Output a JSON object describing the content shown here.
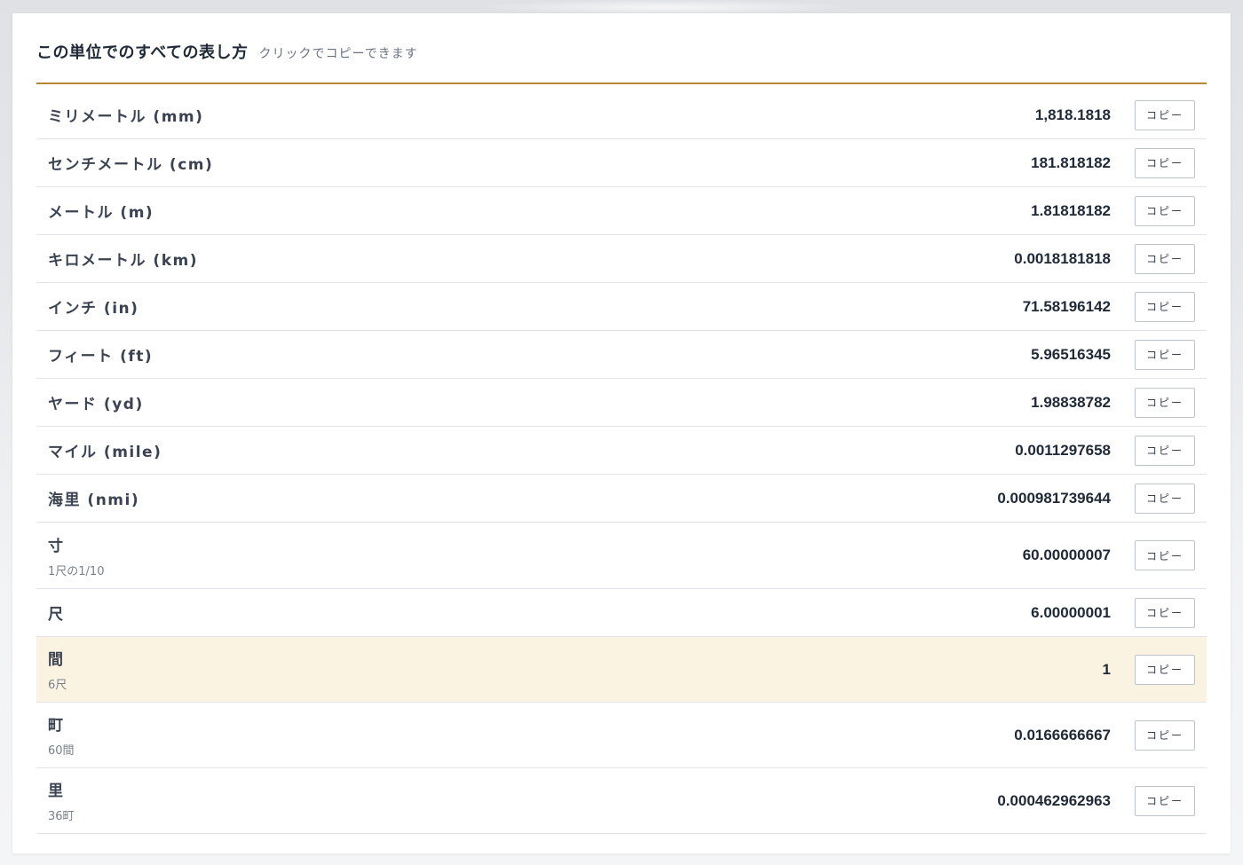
{
  "header": {
    "title": "この単位でのすべての表し方",
    "subtitle": "クリックでコピーできます"
  },
  "copy_label": "コピー",
  "accent_color": "#b8862e",
  "highlight_color": "#faf3e2",
  "rows": [
    {
      "name": "ミリメートル (mm)",
      "note": "",
      "value": "1,818.1818",
      "copy": "コピー"
    },
    {
      "name": "センチメートル (cm)",
      "note": "",
      "value": "181.818182",
      "copy": "コピー"
    },
    {
      "name": "メートル (m)",
      "note": "",
      "value": "1.81818182",
      "copy": "コピー"
    },
    {
      "name": "キロメートル (km)",
      "note": "",
      "value": "0.0018181818",
      "copy": "コピー"
    },
    {
      "name": "インチ (in)",
      "note": "",
      "value": "71.58196142",
      "copy": "コピー"
    },
    {
      "name": "フィート (ft)",
      "note": "",
      "value": "5.96516345",
      "copy": "コピー"
    },
    {
      "name": "ヤード (yd)",
      "note": "",
      "value": "1.98838782",
      "copy": "コピー"
    },
    {
      "name": "マイル (mile)",
      "note": "",
      "value": "0.0011297658",
      "copy": "コピー"
    },
    {
      "name": "海里 (nmi)",
      "note": "",
      "value": "0.000981739644",
      "copy": "コピー"
    },
    {
      "name": "寸",
      "note": "1尺の1/10",
      "value": "60.00000007",
      "copy": "コピー"
    },
    {
      "name": "尺",
      "note": "",
      "value": "6.00000001",
      "copy": "コピー"
    },
    {
      "name": "間",
      "note": "6尺",
      "value": "1",
      "copy": "コピー",
      "selected": true
    },
    {
      "name": "町",
      "note": "60間",
      "value": "0.0166666667",
      "copy": "コピー"
    },
    {
      "name": "里",
      "note": "36町",
      "value": "0.000462962963",
      "copy": "コピー"
    }
  ]
}
